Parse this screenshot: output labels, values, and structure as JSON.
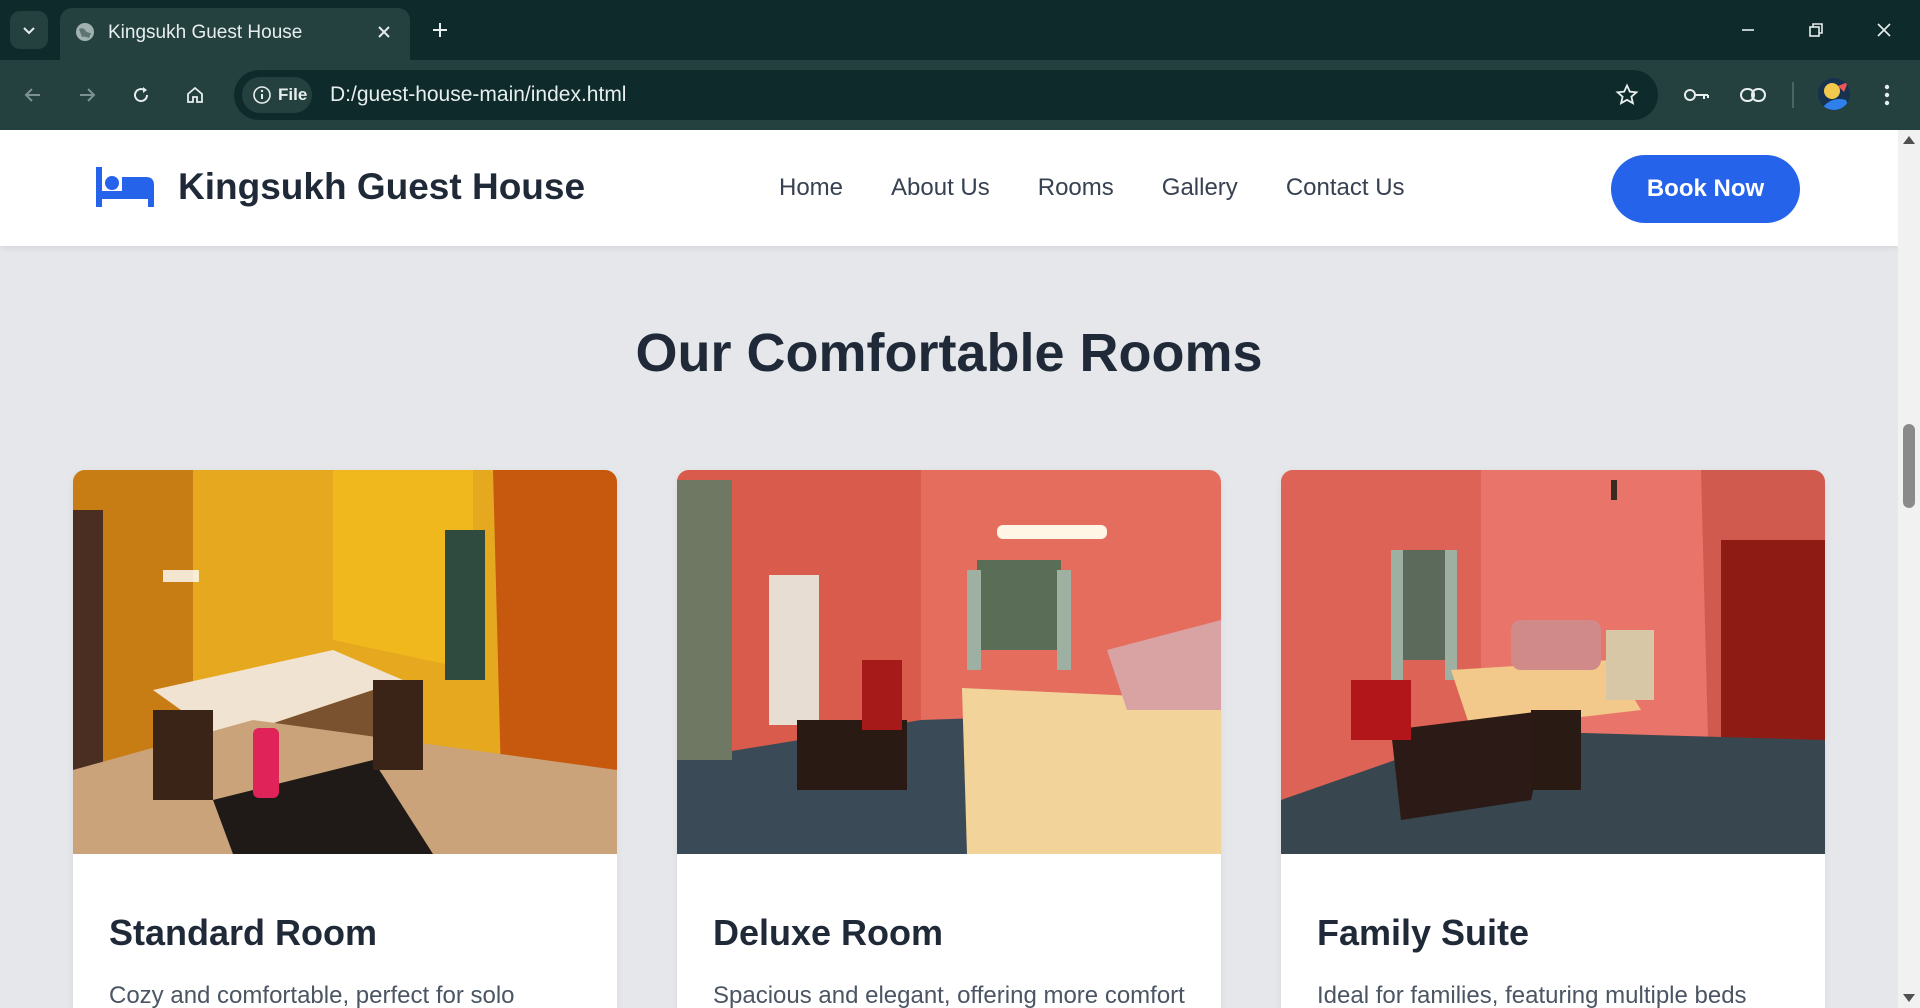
{
  "browser": {
    "tab_title": "Kingsukh Guest House",
    "chip_label": "File",
    "url": "D:/guest-house-main/index.html"
  },
  "site": {
    "brand_name": "Kingsukh Guest House",
    "nav": [
      "Home",
      "About Us",
      "Rooms",
      "Gallery",
      "Contact Us"
    ],
    "book_label": "Book Now",
    "accent": "#2563eb"
  },
  "rooms_section": {
    "title": "Our Comfortable Rooms",
    "rooms": [
      {
        "name": "Standard Room",
        "desc": "Cozy and comfortable, perfect for solo"
      },
      {
        "name": "Deluxe Room",
        "desc": "Spacious and elegant, offering more comfort"
      },
      {
        "name": "Family Suite",
        "desc": "Ideal for families, featuring multiple beds"
      }
    ]
  }
}
